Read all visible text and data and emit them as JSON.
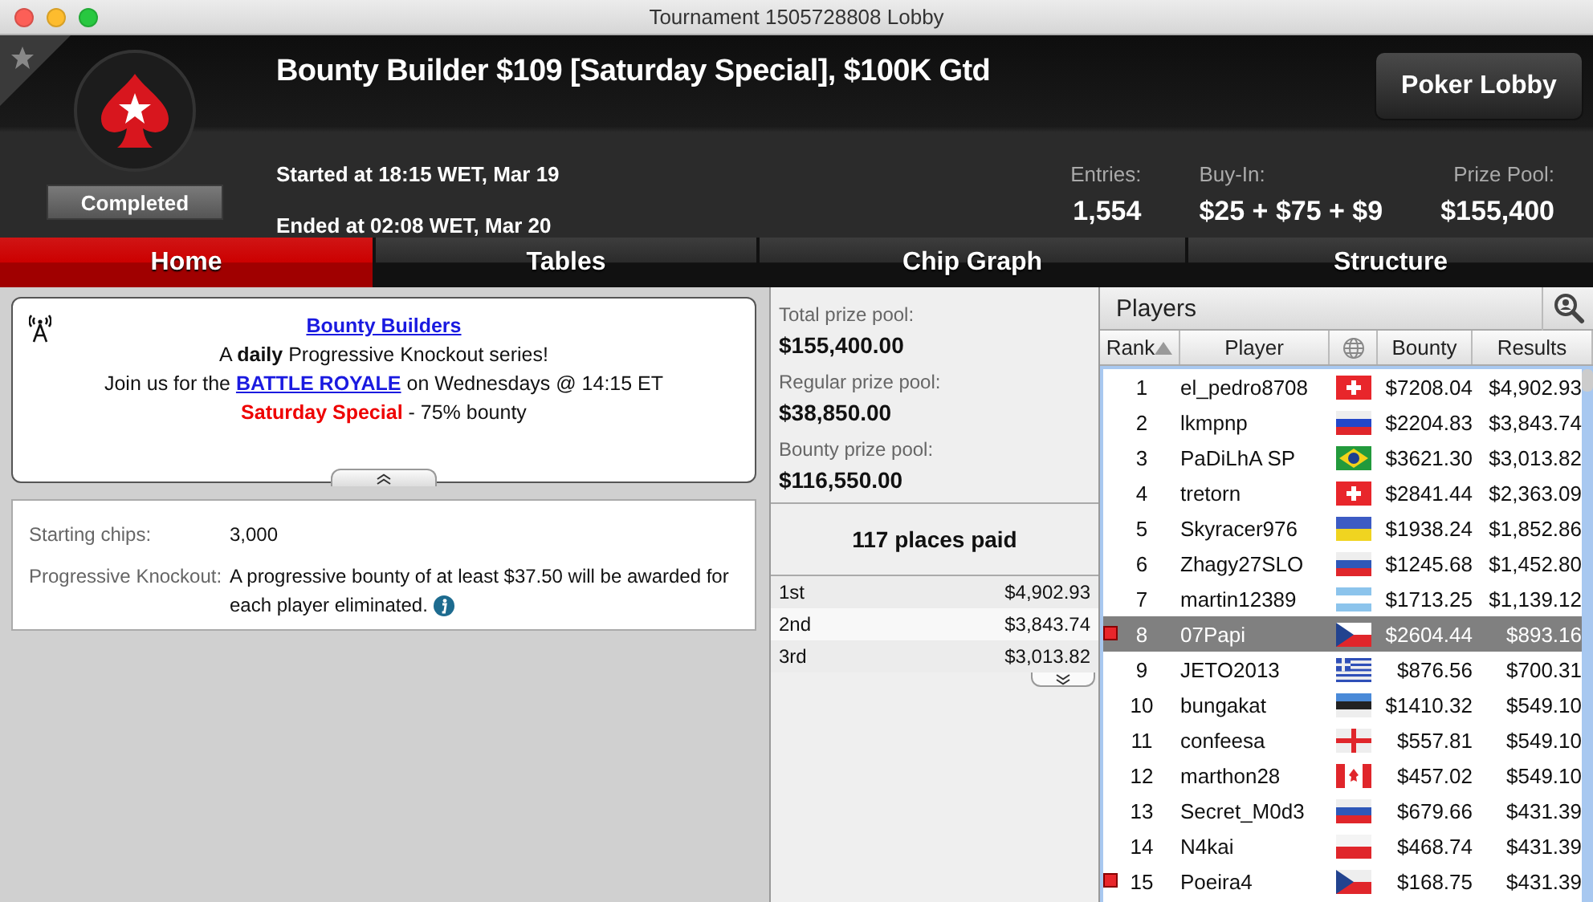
{
  "window": {
    "title": "Tournament 1505728808 Lobby"
  },
  "header": {
    "title": "Bounty Builder $109 [Saturday Special], $100K Gtd",
    "status": "Completed",
    "started": "Started at 18:15 WET, Mar 19",
    "ended": "Ended at 02:08 WET, Mar 20",
    "button": "Poker Lobby",
    "stats": [
      {
        "label": "Entries:",
        "value": "1,554"
      },
      {
        "label": "Buy-In:",
        "value": "$25 + $75 + $9"
      },
      {
        "label": "Prize Pool:",
        "value": "$155,400"
      }
    ]
  },
  "tabs": [
    {
      "label": "Home",
      "selected": true
    },
    {
      "label": "Tables",
      "selected": false
    },
    {
      "label": "Chip Graph",
      "selected": false
    },
    {
      "label": "Structure",
      "selected": false
    }
  ],
  "announcement": {
    "lines": [
      [
        {
          "kind": "link",
          "text": "Bounty Builders"
        }
      ],
      [
        {
          "kind": "plain",
          "text": "A **daily** Progressive Knockout series!"
        }
      ],
      [
        {
          "kind": "plain",
          "text": "Join us for the "
        },
        {
          "kind": "link",
          "text": "BATTLE ROYALE"
        },
        {
          "kind": "plain",
          "text": " on Wednesdays @ 14:15 ET"
        }
      ],
      [
        {
          "kind": "highlight",
          "text": "Saturday Special"
        },
        {
          "kind": "plain",
          "text": " - 75% bounty"
        }
      ]
    ]
  },
  "details": [
    {
      "label": "Starting chips:",
      "value": "3,000",
      "info": false
    },
    {
      "label": "Progressive Knockout:",
      "value": "A progressive bounty of at least $37.50 will be awarded for each player eliminated.",
      "info": true
    }
  ],
  "prize_pools": [
    {
      "label": "Total prize pool:",
      "value": "$155,400.00"
    },
    {
      "label": "Regular prize pool:",
      "value": "$38,850.00"
    },
    {
      "label": "Bounty prize pool:",
      "value": "$116,550.00"
    }
  ],
  "places_paid": "117 places paid",
  "payouts": [
    {
      "place": "1st",
      "amount": "$4,902.93"
    },
    {
      "place": "2nd",
      "amount": "$3,843.74"
    },
    {
      "place": "3rd",
      "amount": "$3,013.82"
    }
  ],
  "players": {
    "title": "Players",
    "columns": [
      {
        "kind": "text",
        "label": "Rank",
        "sorted": true
      },
      {
        "kind": "text",
        "label": "Player",
        "sorted": false
      },
      {
        "kind": "globe",
        "sorted": false
      },
      {
        "kind": "text",
        "label": "Bounty",
        "sorted": false
      },
      {
        "kind": "text",
        "label": "Results",
        "sorted": false
      }
    ],
    "rows": [
      {
        "rank": "1",
        "player": "el_pedro8708",
        "flag": {
          "kind": "cross",
          "parts": [
            {
              "color": "#e8262b"
            },
            {
              "color": "#ffffff"
            }
          ]
        },
        "bounty": "$7208.04",
        "results": "$4,902.93",
        "selected": false,
        "marked": false
      },
      {
        "rank": "2",
        "player": "lkmpnp",
        "flag": {
          "kind": "stripes",
          "parts": [
            {
              "color": "#eeeeee"
            },
            {
              "color": "#2447c8"
            },
            {
              "color": "#e0262b"
            }
          ]
        },
        "bounty": "$2204.83",
        "results": "$3,843.74",
        "selected": false,
        "marked": false
      },
      {
        "rank": "3",
        "player": "PaDiLhA SP",
        "flag": {
          "kind": "diamond",
          "parts": [
            {
              "color": "#229a3c"
            },
            {
              "color": "#f3d21a"
            },
            {
              "color": "#1f3f8f"
            }
          ]
        },
        "bounty": "$3621.30",
        "results": "$3,013.82",
        "selected": false,
        "marked": false
      },
      {
        "rank": "4",
        "player": "tretorn",
        "flag": {
          "kind": "cross",
          "parts": [
            {
              "color": "#e8262b"
            },
            {
              "color": "#ffffff"
            }
          ]
        },
        "bounty": "$2841.44",
        "results": "$2,363.09",
        "selected": false,
        "marked": false
      },
      {
        "rank": "5",
        "player": "Skyracer976",
        "flag": {
          "kind": "stripes",
          "parts": [
            {
              "color": "#3c5bc4"
            },
            {
              "color": "#f0d420"
            }
          ]
        },
        "bounty": "$1938.24",
        "results": "$1,852.86",
        "selected": false,
        "marked": false
      },
      {
        "rank": "6",
        "player": "Zhagy27SLO",
        "flag": {
          "kind": "stripes",
          "parts": [
            {
              "color": "#eeeeee"
            },
            {
              "color": "#2f58b8"
            },
            {
              "color": "#e0262b"
            }
          ]
        },
        "bounty": "$1245.68",
        "results": "$1,452.80",
        "selected": false,
        "marked": false
      },
      {
        "rank": "7",
        "player": "martin12389",
        "flag": {
          "kind": "stripes",
          "parts": [
            {
              "color": "#8cc4ec"
            },
            {
              "color": "#ffffff"
            },
            {
              "color": "#8cc4ec"
            }
          ]
        },
        "bounty": "$1713.25",
        "results": "$1,139.12",
        "selected": false,
        "marked": false
      },
      {
        "rank": "8",
        "player": "07Papi",
        "flag": {
          "kind": "triangle",
          "parts": [
            {
              "color": "#ffffff"
            },
            {
              "color": "#e0262b"
            },
            {
              "color": "#22438f"
            }
          ]
        },
        "bounty": "$2604.44",
        "results": "$893.16",
        "selected": true,
        "marked": true
      },
      {
        "rank": "9",
        "player": "JETO2013",
        "flag": {
          "kind": "canton",
          "parts": [
            {
              "color": "#2f4fb8"
            },
            {
              "color": "#eeeeee"
            }
          ]
        },
        "bounty": "$876.56",
        "results": "$700.31",
        "selected": false,
        "marked": false
      },
      {
        "rank": "10",
        "player": "bungakat",
        "flag": {
          "kind": "stripes",
          "parts": [
            {
              "color": "#4a8ad8"
            },
            {
              "color": "#222222"
            },
            {
              "color": "#eeeeee"
            }
          ]
        },
        "bounty": "$1410.32",
        "results": "$549.10",
        "selected": false,
        "marked": false
      },
      {
        "rank": "11",
        "player": "confeesa",
        "flag": {
          "kind": "quarters",
          "parts": [
            {
              "color": "#eeeeee"
            },
            {
              "color": "#e0262b"
            }
          ]
        },
        "bounty": "$557.81",
        "results": "$549.10",
        "selected": false,
        "marked": false
      },
      {
        "rank": "12",
        "player": "marthon28",
        "flag": {
          "kind": "leaf",
          "parts": [
            {
              "color": "#e0262b"
            },
            {
              "color": "#ffffff"
            }
          ]
        },
        "bounty": "$457.02",
        "results": "$549.10",
        "selected": false,
        "marked": false
      },
      {
        "rank": "13",
        "player": "Secret_M0d3",
        "flag": {
          "kind": "stripes",
          "parts": [
            {
              "color": "#eeeeee"
            },
            {
              "color": "#2f58b8"
            },
            {
              "color": "#e0262b"
            }
          ]
        },
        "bounty": "$679.66",
        "results": "$431.39",
        "selected": false,
        "marked": false
      },
      {
        "rank": "14",
        "player": "N4kai",
        "flag": {
          "kind": "stripes",
          "parts": [
            {
              "color": "#f4f4f4"
            },
            {
              "color": "#e0262b"
            }
          ]
        },
        "bounty": "$468.74",
        "results": "$431.39",
        "selected": false,
        "marked": false
      },
      {
        "rank": "15",
        "player": "Poeira4",
        "flag": {
          "kind": "triangle",
          "parts": [
            {
              "color": "#eeeeee"
            },
            {
              "color": "#e0262b"
            },
            {
              "color": "#22438f"
            }
          ]
        },
        "bounty": "$168.75",
        "results": "$431.39",
        "selected": false,
        "marked": true
      }
    ]
  }
}
